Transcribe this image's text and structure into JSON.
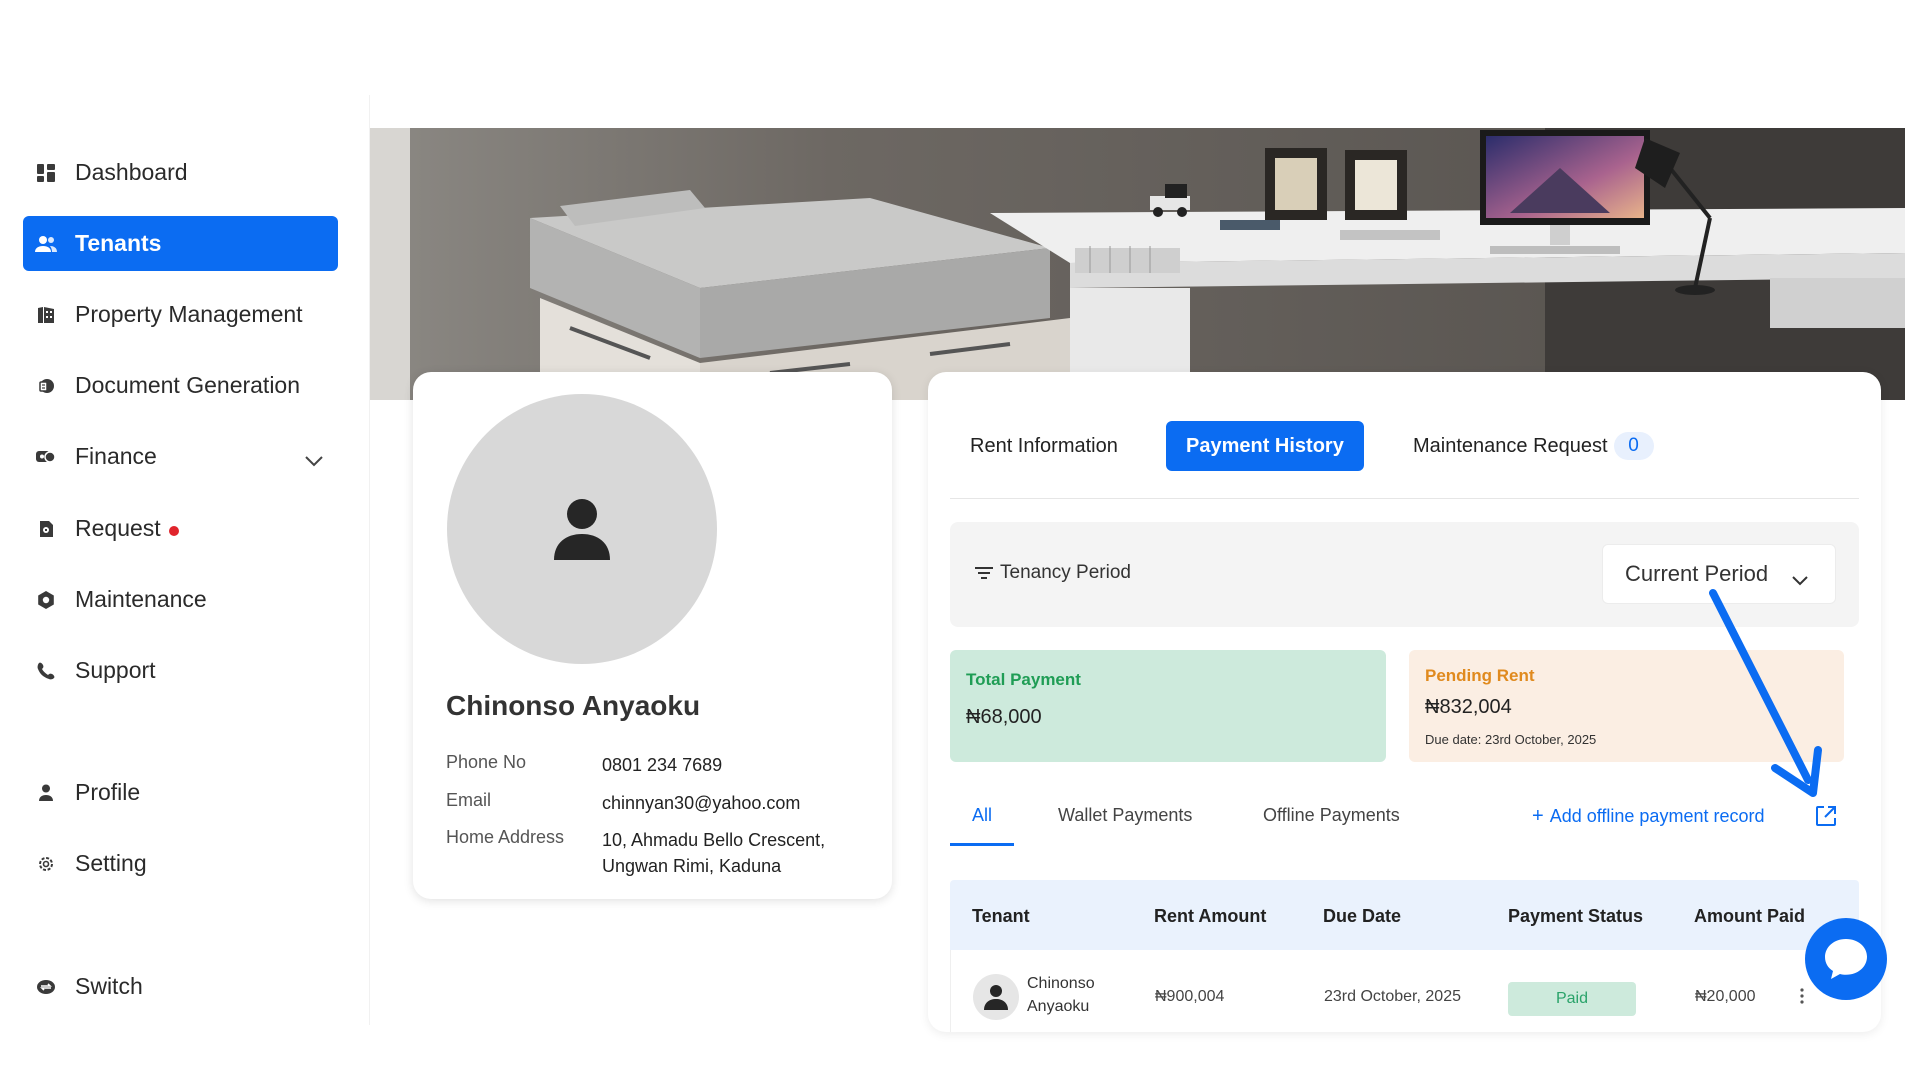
{
  "sidebar": {
    "items": [
      {
        "label": "Dashboard",
        "icon": "dashboard-icon"
      },
      {
        "label": "Tenants",
        "icon": "users-icon",
        "active": true
      },
      {
        "label": "Property Management",
        "icon": "building-icon"
      },
      {
        "label": "Document Generation",
        "icon": "document-icon"
      },
      {
        "label": "Finance",
        "icon": "finance-icon"
      },
      {
        "label": "Request",
        "icon": "request-icon"
      },
      {
        "label": "Maintenance",
        "icon": "maintenance-icon"
      },
      {
        "label": "Support",
        "icon": "phone-icon"
      },
      {
        "label": "Profile",
        "icon": "person-icon"
      },
      {
        "label": "Setting",
        "icon": "gear-icon"
      },
      {
        "label": "Switch",
        "icon": "switch-icon"
      }
    ]
  },
  "profile": {
    "name": "Chinonso Anyaoku",
    "phone_label": "Phone No",
    "phone": "0801 234 7689",
    "email_label": "Email",
    "email": "chinnyan30@yahoo.com",
    "address_label": "Home Address",
    "address": "10, Ahmadu Bello Crescent, Ungwan Rimi, Kaduna"
  },
  "tabs": {
    "rent_info": "Rent Information",
    "payment_history": "Payment History",
    "maintenance": "Maintenance Request",
    "maintenance_count": "0"
  },
  "filter": {
    "label": "Tenancy Period",
    "selected": "Current Period"
  },
  "stats": {
    "total_title": "Total Payment",
    "total_value": "₦68,000",
    "pending_title": "Pending Rent",
    "pending_value": "₦832,004",
    "pending_due": "Due date: 23rd October, 2025"
  },
  "subtabs": {
    "all": "All",
    "wallet": "Wallet Payments",
    "offline": "Offline Payments",
    "add_offline": "Add offline payment record"
  },
  "table": {
    "headers": {
      "tenant": "Tenant",
      "rent": "Rent Amount",
      "due": "Due Date",
      "status": "Payment Status",
      "paid": "Amount Paid"
    },
    "rows": [
      {
        "tenant_first": "Chinonso",
        "tenant_last": "Anyaoku",
        "rent": "₦900,004",
        "due": "23rd October, 2025",
        "status": "Paid",
        "paid": "₦20,000"
      }
    ]
  },
  "colors": {
    "accent": "#0b6cf2",
    "total_text": "#1f9d55",
    "pending_text": "#e08a1e",
    "paid_bg": "#cdeadc",
    "notification": "#e0242c"
  }
}
